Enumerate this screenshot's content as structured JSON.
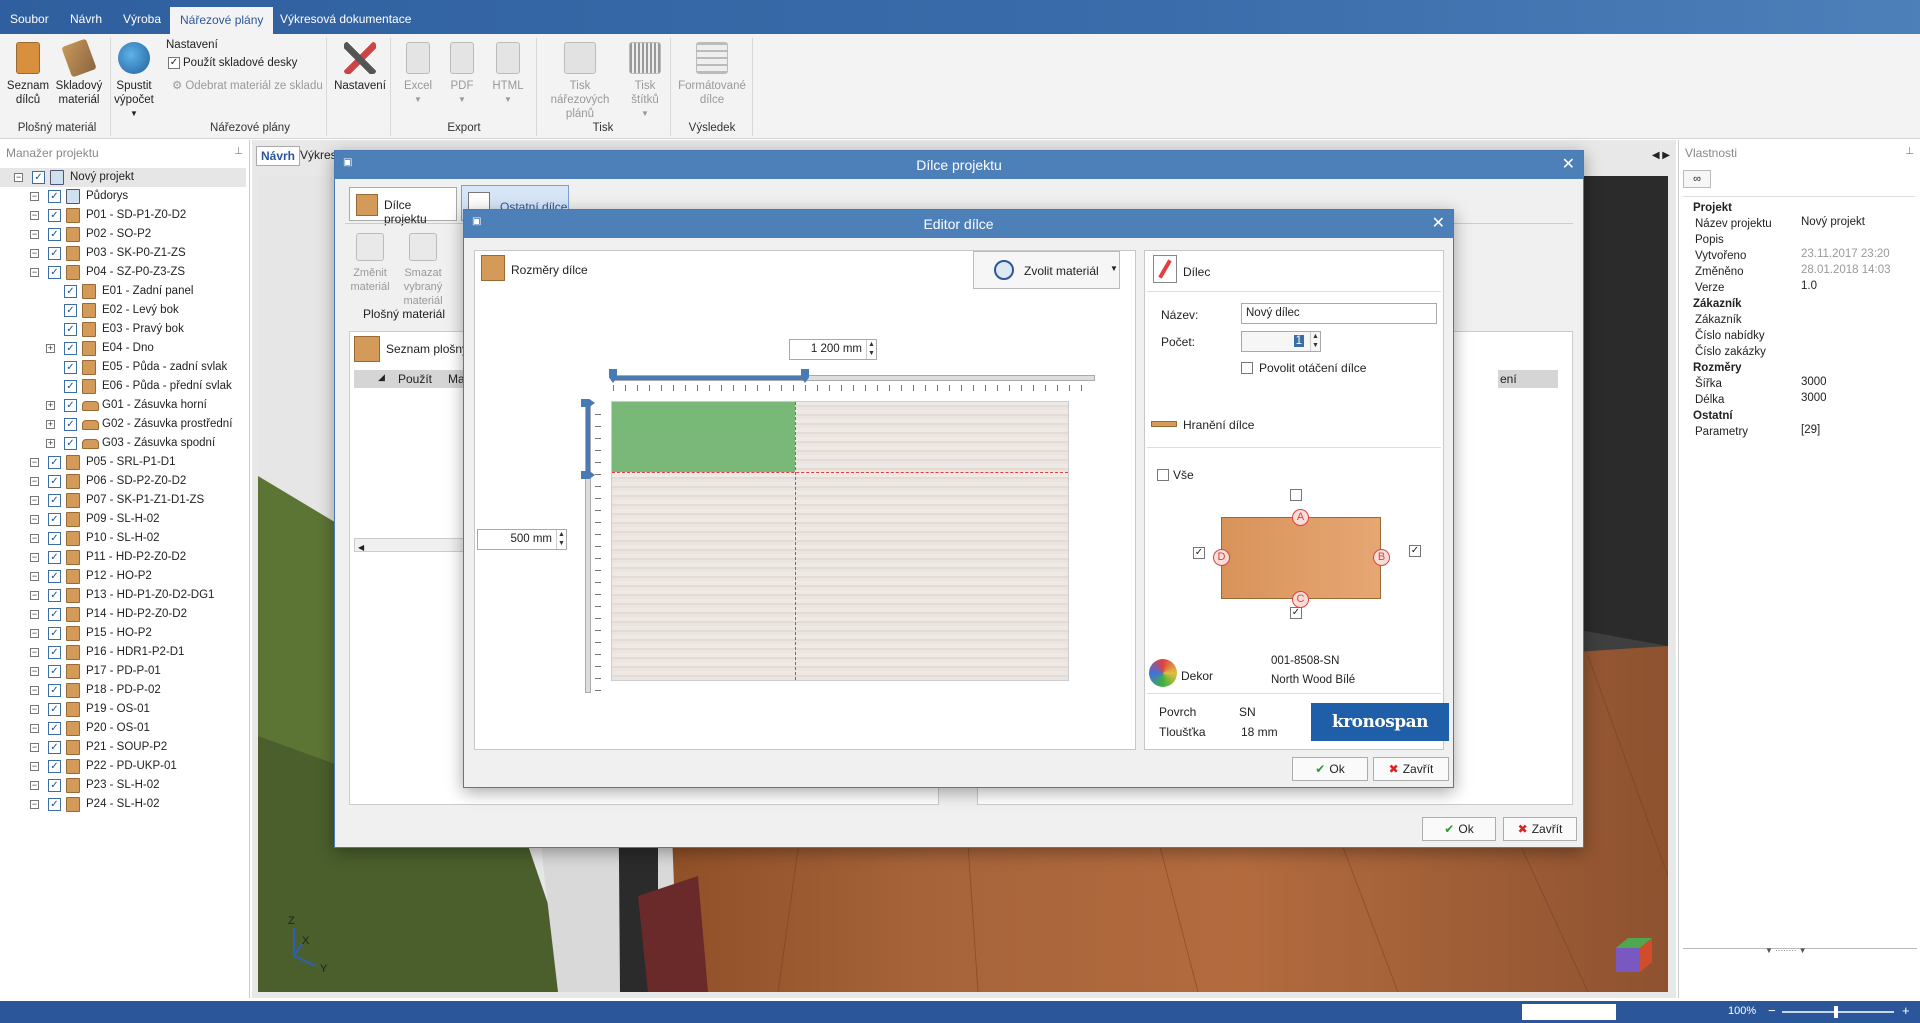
{
  "menu": {
    "tabs": [
      "Soubor",
      "Návrh",
      "Výroba",
      "Nářezové plány",
      "Výkresová dokumentace"
    ],
    "active_tab": "Nářezové plány"
  },
  "ribbon": {
    "seznam_dilcu": "Seznam dílců",
    "skladovy_material": "Skladový materiál",
    "group_plosny": "Plošný materiál",
    "spustit_vypocet": "Spustit výpočet",
    "nastaveni_title": "Nastavení",
    "pouzit_skladove": "Použít skladové desky",
    "odebrat_material": "Odebrat materiál ze skladu",
    "nastaveni": "Nastavení",
    "group_narezove": "Nářezové plány",
    "excel": "Excel",
    "pdf": "PDF",
    "html": "HTML",
    "group_export": "Export",
    "tisk_narezovych": "Tisk nářezových plánů",
    "tisk_stitku": "Tisk štítků",
    "group_tisk": "Tisk",
    "formatovane_dilce": "Formátované dílce",
    "group_vysledek": "Výsledek"
  },
  "project_manager": {
    "title": "Manažer projektu",
    "tree": [
      {
        "label": "Nový projekt",
        "level": 0,
        "icon": "project-icon"
      },
      {
        "label": "Půdorys",
        "level": 1,
        "icon": "floorplan-icon"
      },
      {
        "label": "P01 - SD-P1-Z0-D2",
        "level": 1,
        "icon": "cabinet-icon"
      },
      {
        "label": "P02 - SO-P2",
        "level": 1,
        "icon": "cabinet-icon"
      },
      {
        "label": "P03 - SK-P0-Z1-ZS",
        "level": 1,
        "icon": "cabinet-icon"
      },
      {
        "label": "P04 - SZ-P0-Z3-ZS",
        "level": 1,
        "icon": "cabinet-icon"
      },
      {
        "label": "E01 - Zadní panel",
        "level": 2,
        "icon": "panel-icon"
      },
      {
        "label": "E02 - Levý bok",
        "level": 2,
        "icon": "panel-icon"
      },
      {
        "label": "E03 - Pravý bok",
        "level": 2,
        "icon": "panel-icon"
      },
      {
        "label": "E04 - Dno",
        "level": 2,
        "icon": "panel-icon"
      },
      {
        "label": "E05 - Půda - zadní svlak",
        "level": 2,
        "icon": "panel-icon"
      },
      {
        "label": "E06 - Půda - přední svlak",
        "level": 2,
        "icon": "panel-icon"
      },
      {
        "label": "G01 - Zásuvka horní",
        "level": 2,
        "icon": "drawer-icon"
      },
      {
        "label": "G02 - Zásuvka prostřední",
        "level": 2,
        "icon": "drawer-icon"
      },
      {
        "label": "G03 - Zásuvka spodní",
        "level": 2,
        "icon": "drawer-icon"
      },
      {
        "label": "P05 - SRL-P1-D1",
        "level": 1,
        "icon": "cabinet-icon"
      },
      {
        "label": "P06 - SD-P2-Z0-D2",
        "level": 1,
        "icon": "cabinet-icon"
      },
      {
        "label": "P07 - SK-P1-Z1-D1-ZS",
        "level": 1,
        "icon": "cabinet-icon"
      },
      {
        "label": "P09 - SL-H-02",
        "level": 1,
        "icon": "cabinet-icon"
      },
      {
        "label": "P10 - SL-H-02",
        "level": 1,
        "icon": "cabinet-icon"
      },
      {
        "label": "P11 - HD-P2-Z0-D2",
        "level": 1,
        "icon": "cabinet-icon"
      },
      {
        "label": "P12 - HO-P2",
        "level": 1,
        "icon": "cabinet-icon"
      },
      {
        "label": "P13 - HD-P1-Z0-D2-DG1",
        "level": 1,
        "icon": "cabinet-icon"
      },
      {
        "label": "P14 - HD-P2-Z0-D2",
        "level": 1,
        "icon": "cabinet-icon"
      },
      {
        "label": "P15 - HO-P2",
        "level": 1,
        "icon": "cabinet-icon"
      },
      {
        "label": "P16 - HDR1-P2-D1",
        "level": 1,
        "icon": "cabinet-icon"
      },
      {
        "label": "P17 - PD-P-01",
        "level": 1,
        "icon": "cabinet-icon"
      },
      {
        "label": "P18 - PD-P-02",
        "level": 1,
        "icon": "cabinet-icon"
      },
      {
        "label": "P19 - OS-01",
        "level": 1,
        "icon": "cabinet-icon"
      },
      {
        "label": "P20 - OS-01",
        "level": 1,
        "icon": "cabinet-icon"
      },
      {
        "label": "P21 - SOUP-P2",
        "level": 1,
        "icon": "cabinet-icon"
      },
      {
        "label": "P22 - PD-UKP-01",
        "level": 1,
        "icon": "cabinet-icon"
      },
      {
        "label": "P23 - SL-H-02",
        "level": 1,
        "icon": "cabinet-icon"
      },
      {
        "label": "P24 - SL-H-02",
        "level": 1,
        "icon": "cabinet-icon"
      }
    ]
  },
  "viewport": {
    "tab_navrh": "Návrh",
    "tab_vykres": "Výkres",
    "axis_z": "Z",
    "axis_x": "X",
    "axis_y": "Y"
  },
  "properties": {
    "title": "Vlastnosti",
    "rows": [
      {
        "label": "Projekt",
        "value": "",
        "bold": true
      },
      {
        "label": "Název projektu",
        "value": "Nový projekt"
      },
      {
        "label": "Popis",
        "value": ""
      },
      {
        "label": "Vytvořeno",
        "value": "23.11.2017 23:20",
        "muted": true
      },
      {
        "label": "Změněno",
        "value": "28.01.2018 14:03",
        "muted": true
      },
      {
        "label": "Verze",
        "value": "1.0"
      },
      {
        "label": "Zákazník",
        "value": "",
        "bold": true
      },
      {
        "label": "Zákazník",
        "value": ""
      },
      {
        "label": "Číslo nabídky",
        "value": ""
      },
      {
        "label": "Číslo zakázky",
        "value": ""
      },
      {
        "label": "Rozměry",
        "value": "",
        "bold": true
      },
      {
        "label": "Šířka",
        "value": "3000"
      },
      {
        "label": "Délka",
        "value": "3000"
      },
      {
        "label": "Ostatní",
        "value": "",
        "bold": true
      },
      {
        "label": "Parametry",
        "value": "[29]"
      }
    ]
  },
  "status": {
    "zoom": "100%"
  },
  "dilce_dialog": {
    "title": "Dílce projektu",
    "tab1": "Dílce projektu",
    "tab2": "Ostatní dílce",
    "zmenit_material": "Změnit materiál",
    "smazat_vybrany": "Smazat vybraný materiál",
    "group_plosny": "Plošný materiál",
    "seznam_plosnych": "Seznam plošných",
    "col_pouzit": "Použít",
    "col_mat": "Mat",
    "col_right": "ení",
    "ok": "Ok",
    "zavrit": "Zavřít"
  },
  "editor": {
    "title": "Editor dílce",
    "rozmery": "Rozměry dílce",
    "zvolit_material": "Zvolit materiál",
    "width_value": "1 200 mm",
    "height_value": "500 mm",
    "width_fraction": 0.4,
    "height_fraction": 0.25,
    "dilec": "Dílec",
    "nazev_label": "Název:",
    "nazev_value": "Nový dílec",
    "pocet_label": "Počet:",
    "pocet_value": "1",
    "povolit_otaceni": "Povolit otáčení dílce",
    "hraneni": "Hranění dílce",
    "vse": "Vše",
    "edge_a": "A",
    "edge_b": "B",
    "edge_c": "C",
    "edge_d": "D",
    "dekor_label": "Dekor",
    "dekor_code": "001-8508-SN",
    "dekor_name": "North Wood Bílé",
    "povrch_label": "Povrch",
    "povrch_value": "SN",
    "tloustka_label": "Tloušťka",
    "tloustka_value": "18 mm",
    "brand": "kronospan",
    "ok": "Ok",
    "zavrit": "Zavřít"
  }
}
